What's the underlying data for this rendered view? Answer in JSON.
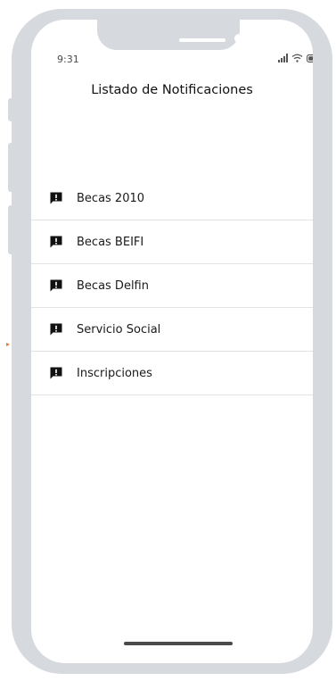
{
  "status_bar": {
    "time": "9:31",
    "icons": [
      "signal-icon",
      "wifi-icon",
      "battery-icon"
    ]
  },
  "header": {
    "title": "Listado de Notificaciones"
  },
  "notifications": [
    {
      "label": "Becas 2010",
      "icon": "notification-alert-icon"
    },
    {
      "label": "Becas BEIFI",
      "icon": "notification-alert-icon"
    },
    {
      "label": "Becas Delfin",
      "icon": "notification-alert-icon"
    },
    {
      "label": "Servicio Social",
      "icon": "notification-alert-icon"
    },
    {
      "label": "Inscripciones",
      "icon": "notification-alert-icon"
    }
  ],
  "colors": {
    "frame": "#d6d9dd",
    "screen": "#ffffff",
    "text": "#1a1a1a",
    "divider": "#e3e3e3",
    "marker": "#f07a2b"
  }
}
